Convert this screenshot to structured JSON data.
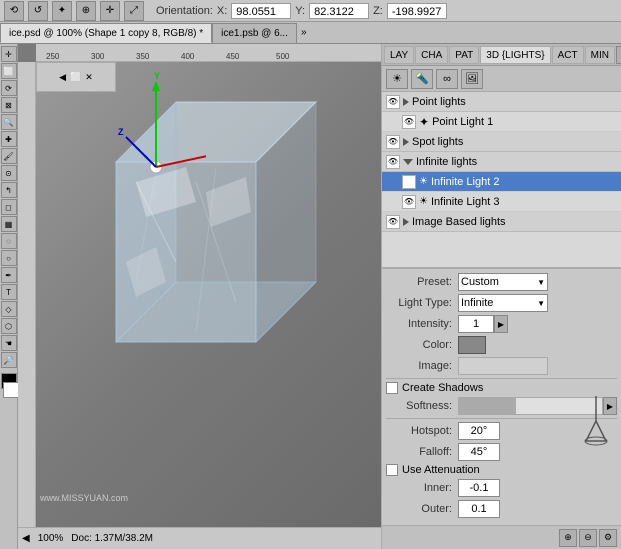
{
  "topbar": {
    "orientation_label": "Orientation:",
    "x_label": "X:",
    "x_val": "98.0551",
    "y_label": "Y:",
    "y_val": "82.3122",
    "z_label": "Z:",
    "z_val": "-198.9927"
  },
  "tabs": {
    "tab1": "ice.psd @ 100% (Shape 1 copy 8, RGB/8) *",
    "tab2": "ice1.psb @ 6..."
  },
  "panel": {
    "tabs": [
      "LAY",
      "CHA",
      "PAT",
      "3D {LIGHTS}",
      "ACT",
      "MIN"
    ],
    "active_tab": "3D {LIGHTS}"
  },
  "light_tree": {
    "groups": [
      {
        "name": "Point lights",
        "items": [
          {
            "name": "Point Light 1",
            "selected": false
          }
        ]
      },
      {
        "name": "Spot lights",
        "items": []
      },
      {
        "name": "Infinite lights",
        "items": [
          {
            "name": "Infinite Light 2",
            "selected": true
          },
          {
            "name": "Infinite Light 3",
            "selected": false
          }
        ]
      },
      {
        "name": "Image Based lights",
        "items": []
      }
    ]
  },
  "properties": {
    "preset_label": "Preset:",
    "preset_value": "Custom",
    "light_type_label": "Light Type:",
    "light_type_value": "Infinite",
    "intensity_label": "Intensity:",
    "intensity_value": "1",
    "color_label": "Color:",
    "image_label": "Image:",
    "create_shadows_label": "Create Shadows",
    "softness_label": "Softness:",
    "hotspot_label": "Hotspot:",
    "hotspot_value": "20°",
    "falloff_label": "Falloff:",
    "falloff_value": "45°",
    "use_attenuation_label": "Use Attenuation",
    "inner_label": "Inner:",
    "inner_value": "-0.1",
    "outer_label": "Outer:",
    "outer_value": "0.1"
  },
  "status": {
    "zoom": "100%",
    "doc_size": "Doc: 1.37M/38.2M"
  },
  "watermark": "www.MISSYUAN.com"
}
